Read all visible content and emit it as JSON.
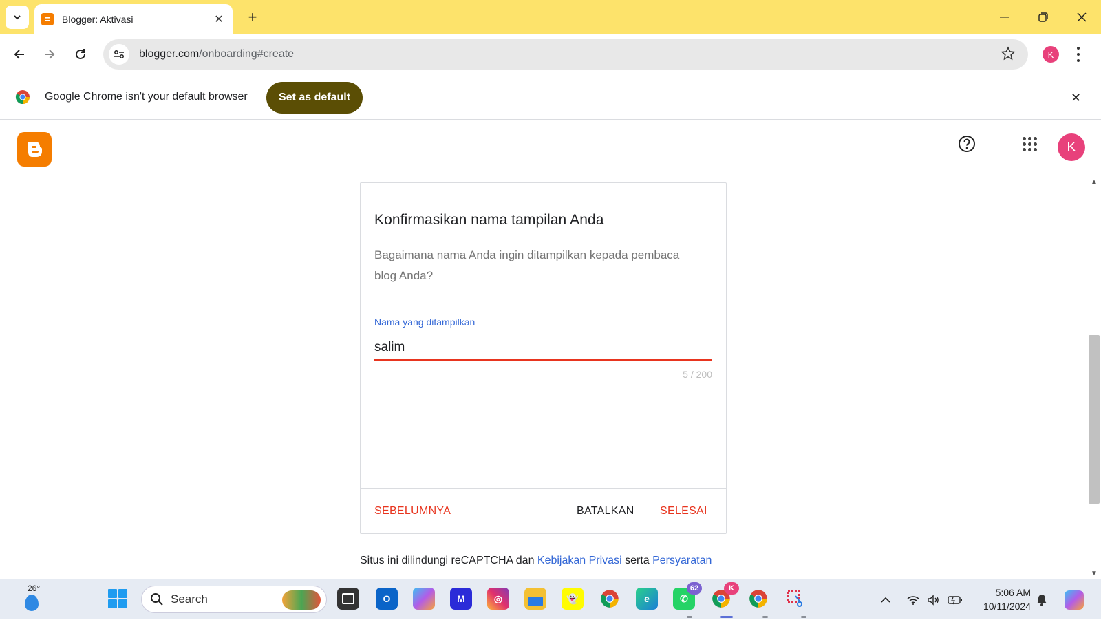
{
  "browser": {
    "tab_title": "Blogger: Aktivasi",
    "url_host": "blogger.com",
    "url_path": "/onboarding#create",
    "profile_initial": "K"
  },
  "infobar": {
    "message": "Google Chrome isn't your default browser",
    "set_default_label": "Set as default"
  },
  "blogger": {
    "avatar_initial": "K"
  },
  "dialog": {
    "title": "Konfirmasikan nama tampilan Anda",
    "description": "Bagaimana nama Anda ingin ditampilkan kepada pembaca blog Anda?",
    "field_label": "Nama yang ditampilkan",
    "field_value": "salim",
    "counter": "5 / 200",
    "prev_label": "SEBELUMNYA",
    "cancel_label": "BATALKAN",
    "done_label": "SELESAI"
  },
  "footer": {
    "text_before": "Situs ini dilindungi reCAPTCHA dan ",
    "privacy_link": "Kebijakan Privasi",
    "text_middle": " serta ",
    "terms_link": "Persyaratan"
  },
  "taskbar": {
    "weather_temp": "26°",
    "search_label": "Search",
    "whatsapp_badge": "62",
    "chrome_badge": "K",
    "time": "5:06 AM",
    "date": "10/11/2024"
  },
  "colors": {
    "titlebar": "#fde36b",
    "blogger_orange": "#f57d00",
    "accent_red": "#e8351f",
    "link_blue": "#3367d6",
    "set_default_btn": "#5b4e05"
  }
}
